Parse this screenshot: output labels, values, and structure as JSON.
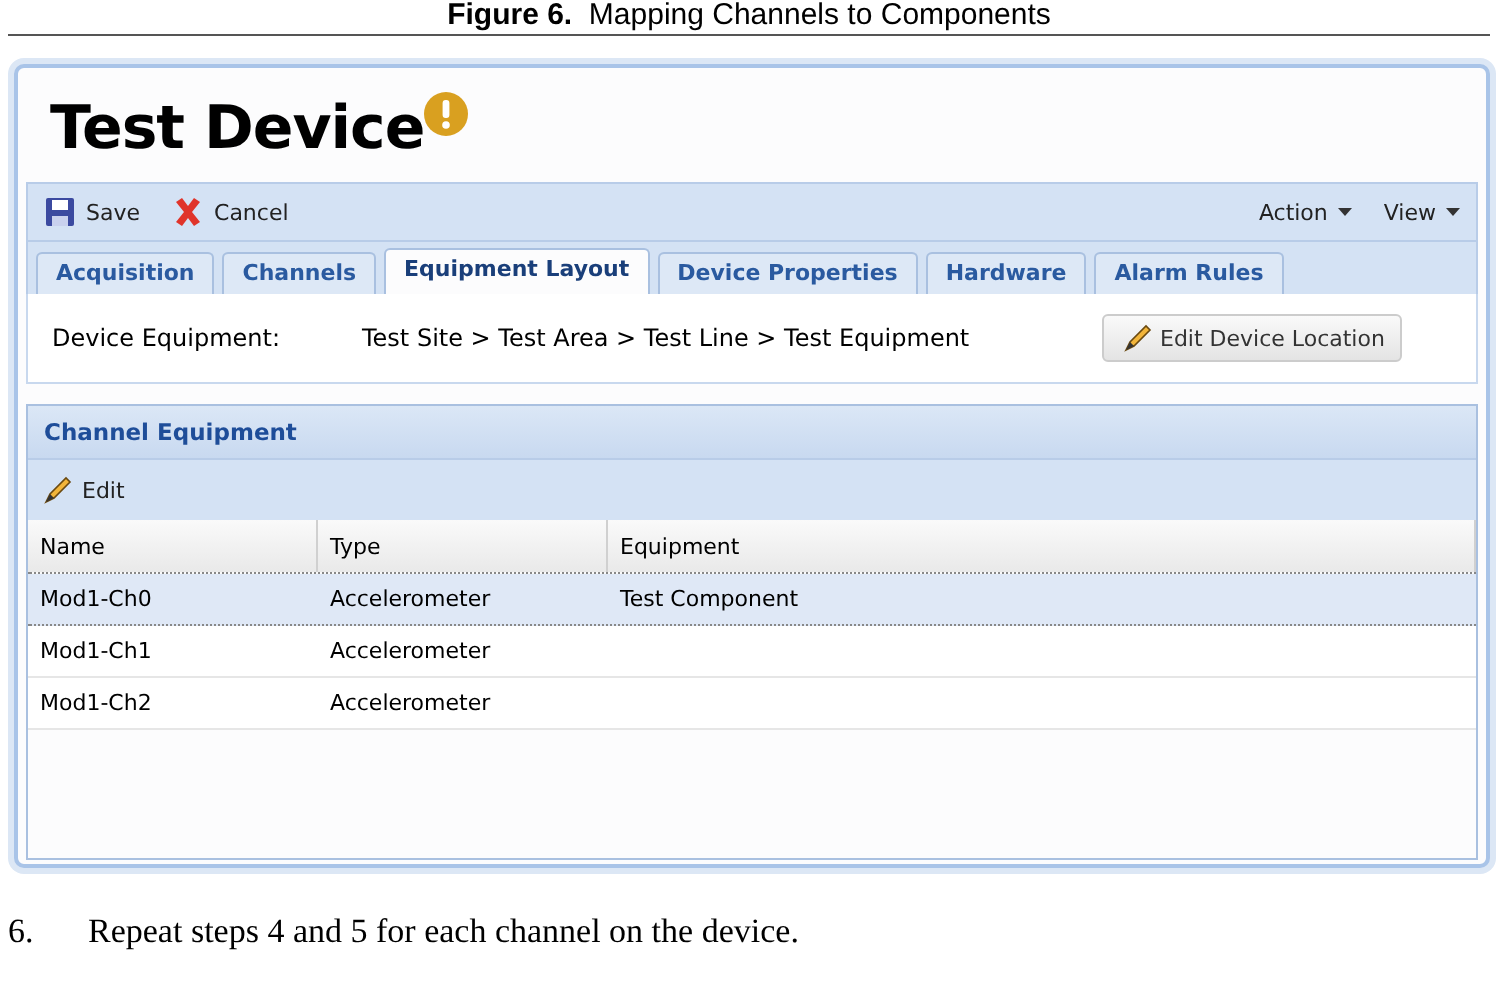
{
  "caption": {
    "label": "Figure 6.",
    "text": "Mapping Channels to Components"
  },
  "window": {
    "title": "Test Device",
    "warning": true
  },
  "toolbar": {
    "left": [
      {
        "label": "Save",
        "kind": "save"
      },
      {
        "label": "Cancel",
        "kind": "cancel"
      }
    ],
    "right": [
      {
        "label": "Action"
      },
      {
        "label": "View"
      }
    ]
  },
  "tabs": [
    {
      "label": "Acquisition",
      "selected": false
    },
    {
      "label": "Channels",
      "selected": false
    },
    {
      "label": "Equipment Layout",
      "selected": true
    },
    {
      "label": "Device Properties",
      "selected": false
    },
    {
      "label": "Hardware",
      "selected": false
    },
    {
      "label": "Alarm Rules",
      "selected": false
    }
  ],
  "device_equipment": {
    "label": "Device Equipment:",
    "path": "Test Site > Test Area > Test Line > Test Equipment",
    "button": "Edit Device Location"
  },
  "channel_equipment": {
    "title": "Channel Equipment",
    "edit_button": "Edit",
    "columns": [
      "Name",
      "Type",
      "Equipment"
    ],
    "rows": [
      {
        "cells": [
          "Mod1-Ch0",
          "Accelerometer",
          "Test Component"
        ],
        "selected": true
      },
      {
        "cells": [
          "Mod1-Ch1",
          "Accelerometer",
          ""
        ],
        "selected": false
      },
      {
        "cells": [
          "Mod1-Ch2",
          "Accelerometer",
          ""
        ],
        "selected": false
      }
    ]
  },
  "step": {
    "number": "6.",
    "text": "Repeat steps 4 and 5 for each channel on the device."
  }
}
